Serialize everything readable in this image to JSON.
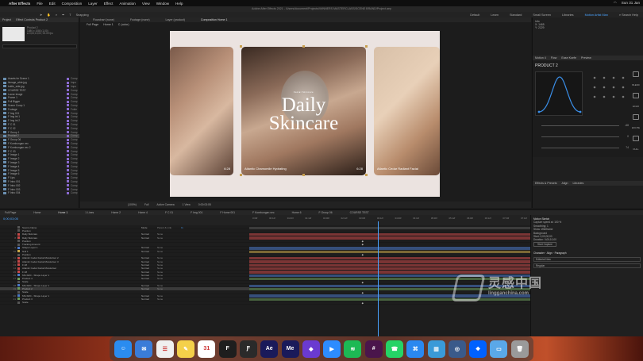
{
  "menubar": {
    "app": "After Effects",
    "items": [
      "File",
      "Edit",
      "Composition",
      "Layer",
      "Effect",
      "Animation",
      "View",
      "Window",
      "Help"
    ],
    "clock": "Sun 31 Jan"
  },
  "titlebar": {
    "text": "Adobe After Effects 2021 - /Users/document/Projects/WINNERS MASTERCLASS/SCENE BRAND/Project.aep"
  },
  "toolbar": {
    "snapping": "Snapping",
    "workspaces": [
      "Default",
      "Learn",
      "Standard",
      "Small Screen",
      "Libraries",
      "Motion Artist Man"
    ],
    "active_workspace": "Motion Artist Man",
    "search": "Search Help"
  },
  "project": {
    "tabs": [
      "Project",
      "Effect Controls Product 2"
    ],
    "info_lines": [
      "Product 2",
      "1080 x 1080 (1.00)",
      "Δ 0;00;10;00, 25.00 fps"
    ],
    "items": [
      {
        "name": "Assets for Scene 1",
        "type": "Comp"
      },
      {
        "name": "lineage_wide.jpg",
        "type": "Impo"
      },
      {
        "name": "bottle_side.jpg",
        "type": "Impo"
      },
      {
        "name": "COURSE TEST",
        "type": "Comp"
      },
      {
        "name": "Loose Image",
        "type": "Comp"
      },
      {
        "name": "Frame 1",
        "type": "Comp"
      },
      {
        "name": "Full Bigger",
        "type": "Comp"
      },
      {
        "name": "Scene Comp 1",
        "type": "Comp"
      },
      {
        "name": "Footage",
        "type": "Folde"
      },
      {
        "name": "F Img 001",
        "type": "Comp"
      },
      {
        "name": "F Img int 1",
        "type": "Comp"
      },
      {
        "name": "F Img int 2",
        "type": "Comp"
      },
      {
        "name": "F C 01",
        "type": "Comp"
      },
      {
        "name": "F C 02",
        "type": "Comp"
      },
      {
        "name": "F Group 1",
        "type": "Comp"
      },
      {
        "name": "Product 2",
        "type": "Comp"
      },
      {
        "name": "F Group 06",
        "type": "Comp"
      },
      {
        "name": "F Kombungan vec",
        "type": "Comp"
      },
      {
        "name": "F Kombungan vec 2",
        "type": "Comp"
      },
      {
        "name": "F C 03",
        "type": "Comp"
      },
      {
        "name": "F Image 1",
        "type": "Comp"
      },
      {
        "name": "F Image 2",
        "type": "Comp"
      },
      {
        "name": "F Image 3",
        "type": "Comp"
      },
      {
        "name": "F Image 4",
        "type": "Comp"
      },
      {
        "name": "F Image 5",
        "type": "Comp"
      },
      {
        "name": "F Image 6",
        "type": "Comp"
      },
      {
        "name": "F Lips",
        "type": "Comp"
      },
      {
        "name": "F Intro 001",
        "type": "Comp"
      },
      {
        "name": "F Intro 002",
        "type": "Comp"
      },
      {
        "name": "F Intro 003",
        "type": "Comp"
      },
      {
        "name": "F Intro 004",
        "type": "Comp"
      }
    ],
    "selected_index": 15
  },
  "composition": {
    "tabs": [
      "Flowchart (none)",
      "Footage (none)",
      "Layer (product)",
      "Composition Home 1"
    ],
    "active_tab": "Composition Home 1",
    "breadcrumbs": [
      "Full Page",
      "Home 1",
      "C (color)"
    ],
    "headline_line1": "Daily",
    "headline_line2": "Skincare",
    "subline": "Facial Skincare",
    "card_left_num": "6:28",
    "card_mid_caption": "Atlantic Chamomile Hydrating",
    "card_mid_num": "6:28",
    "card_right_caption": "Atlantic Cedar Radiant Facial",
    "footer": [
      "(100%)",
      "Full",
      "Active Camera",
      "1 View",
      "0:00:03:05"
    ]
  },
  "right_panel": {
    "info_label": "Info",
    "info_values": [
      "X: 1465",
      "Y: 2229"
    ],
    "motion_tabs": [
      "Motion 4",
      "Flow",
      "Ease Koefe",
      "Preview"
    ],
    "motion_title": "PRODUCT 2",
    "tools": [
      "BLEND",
      "ECHO",
      "EXCITE",
      "NULL",
      "DELAY",
      "BURST",
      "CLOTH"
    ],
    "slider_values": [
      "-68",
      "0",
      "74"
    ],
    "lower_tabs": [
      "Effects & Presets",
      "Align",
      "Libraries"
    ],
    "character_tabs": [
      "Character",
      "Align",
      "Paragraph"
    ],
    "font": "Editorial New",
    "font_style": "Regular"
  },
  "timeline": {
    "tabs": [
      "Full Page",
      "Home",
      "Home 1",
      "1 Lines",
      "Home 2",
      "Home 4",
      "F C 01",
      "F Img 001",
      "F Home 001",
      "F Kombungan vec",
      "Home 6",
      "F Group 06",
      "COURSE TEST"
    ],
    "active_tab": "Home 1",
    "timecode": "0;00;03;05",
    "ruler": [
      "0:00f",
      "00:12f",
      "01:00f",
      "01:12f",
      "02:00f",
      "02:12f",
      "03:00f",
      "03:12f",
      "04:00f",
      "04:12f",
      "05:00f",
      "05:12f",
      "06:00f",
      "06:12f",
      "07:00f",
      "07:12f"
    ],
    "layers": [
      {
        "num": "",
        "name": "Source Name",
        "mode": "Mode",
        "parent": "Parent & Link",
        "time": "In",
        "color": "#555"
      },
      {
        "num": "",
        "name": "Position",
        "mode": "",
        "parent": "",
        "time": "",
        "color": "#555"
      },
      {
        "num": "7",
        "name": "Daily Skincare",
        "mode": "Normal",
        "parent": "None",
        "time": "",
        "color": "#c84848"
      },
      {
        "num": "8",
        "name": "Daily Skincare",
        "mode": "Normal",
        "parent": "None",
        "time": "",
        "color": "#c84848"
      },
      {
        "num": "",
        "name": "Position",
        "mode": "",
        "parent": "",
        "time": "",
        "color": "#555"
      },
      {
        "num": "",
        "name": "Tracking Amount",
        "mode": "",
        "parent": "",
        "time": "",
        "color": "#555"
      },
      {
        "num": "9",
        "name": "Shape Layer 1",
        "mode": "Normal",
        "parent": "None",
        "time": "",
        "color": "#4a78c8"
      },
      {
        "num": "10",
        "name": "Null 1",
        "mode": "Normal",
        "parent": "None",
        "time": "",
        "color": "#c8a848"
      },
      {
        "num": "",
        "name": "Position",
        "mode": "",
        "parent": "",
        "time": "",
        "color": "#555"
      },
      {
        "num": "11",
        "name": "Atlantic Cedar Facial Moisturiser 2",
        "mode": "Normal",
        "parent": "None",
        "time": "",
        "color": "#c84848"
      },
      {
        "num": "12",
        "name": "Atlantic Cedar Facial Moisturiser 3",
        "mode": "Normal",
        "parent": "None",
        "time": "",
        "color": "#c84848"
      },
      {
        "num": "13",
        "name": "F 28",
        "mode": "Normal",
        "parent": "None",
        "time": "",
        "color": "#c84848"
      },
      {
        "num": "14",
        "name": "Atlantic Cedar Facial Moisturiser",
        "mode": "Normal",
        "parent": "None",
        "time": "",
        "color": "#c84848"
      },
      {
        "num": "15",
        "name": "F 28",
        "mode": "Normal",
        "parent": "None",
        "time": "",
        "color": "#c84848"
      },
      {
        "num": "16",
        "name": "MS-SRC - Shape Layer 1",
        "mode": "Normal",
        "parent": "None",
        "time": "",
        "color": "#4a78c8"
      },
      {
        "num": "17",
        "name": "Product 4",
        "mode": "Normal",
        "parent": "None",
        "time": "",
        "color": "#6a9a5a"
      },
      {
        "num": "",
        "name": "Scale",
        "mode": "",
        "parent": "",
        "time": "",
        "color": "#555"
      },
      {
        "num": "18",
        "name": "MS-SRC - Shape Layer 1",
        "mode": "Normal",
        "parent": "None",
        "time": "",
        "color": "#4a78c8"
      },
      {
        "num": "19",
        "name": "Product 2",
        "mode": "Normal",
        "parent": "None",
        "time": "",
        "color": "#6a9a5a"
      },
      {
        "num": "",
        "name": "Scale",
        "mode": "",
        "parent": "",
        "time": "",
        "color": "#555"
      },
      {
        "num": "20",
        "name": "MS-SRC - Shape Layer 1",
        "mode": "Normal",
        "parent": "None",
        "time": "",
        "color": "#4a78c8"
      },
      {
        "num": "21",
        "name": "Product 3",
        "mode": "Normal",
        "parent": "None",
        "time": "",
        "color": "#6a9a5a"
      },
      {
        "num": "",
        "name": "Scale",
        "mode": "",
        "parent": "",
        "time": "",
        "color": "#555"
      }
    ],
    "selected_layer": 18,
    "right_title": "Motion Sketch",
    "right_lines": [
      "Capture speed at: 100 %",
      "Smoothing: 1",
      "Show: Wireframe",
      "Background",
      "Start: 0;00;00;00",
      "Duration: 0;00;10;00",
      "Start Capture"
    ]
  },
  "dock": {
    "apps": [
      {
        "name": "Finder",
        "color": "#2a8cf0",
        "glyph": "☺"
      },
      {
        "name": "Mail",
        "color": "#3a7cd8",
        "glyph": "✉"
      },
      {
        "name": "Reminders",
        "color": "#f0f0f0",
        "glyph": "☰"
      },
      {
        "name": "Notes",
        "color": "#f4d04a",
        "glyph": "✎"
      },
      {
        "name": "Calendar",
        "color": "#ffffff",
        "glyph": "31"
      },
      {
        "name": "Figma",
        "color": "#1e1e1e",
        "glyph": "F"
      },
      {
        "name": "Font app",
        "color": "#2a2a2a",
        "glyph": "Ƒ"
      },
      {
        "name": "After Effects",
        "color": "#1a1a5a",
        "glyph": "Ae"
      },
      {
        "name": "Media Encoder",
        "color": "#1a1a5a",
        "glyph": "Me"
      },
      {
        "name": "Affinity",
        "color": "#6a3ad0",
        "glyph": "◆"
      },
      {
        "name": "Zoom",
        "color": "#2d8cff",
        "glyph": "▶"
      },
      {
        "name": "Spotify",
        "color": "#1db954",
        "glyph": "≋"
      },
      {
        "name": "Slack",
        "color": "#4a154b",
        "glyph": "#"
      },
      {
        "name": "WhatsApp",
        "color": "#25d366",
        "glyph": "☎"
      },
      {
        "name": "Safari",
        "color": "#2a88f0",
        "glyph": "⌘"
      },
      {
        "name": "Toolbox",
        "color": "#3a9ad8",
        "glyph": "▥"
      },
      {
        "name": "Disk Utility",
        "color": "#3a5a8a",
        "glyph": "◎"
      },
      {
        "name": "Dropbox",
        "color": "#0061ff",
        "glyph": "❖"
      },
      {
        "name": "Folder",
        "color": "#5aa8e8",
        "glyph": "▭"
      },
      {
        "name": "Trash",
        "color": "#9a9a9a",
        "glyph": "🗑"
      }
    ]
  },
  "watermark": {
    "cn": "灵感中国",
    "url": "lingganchina.com"
  }
}
